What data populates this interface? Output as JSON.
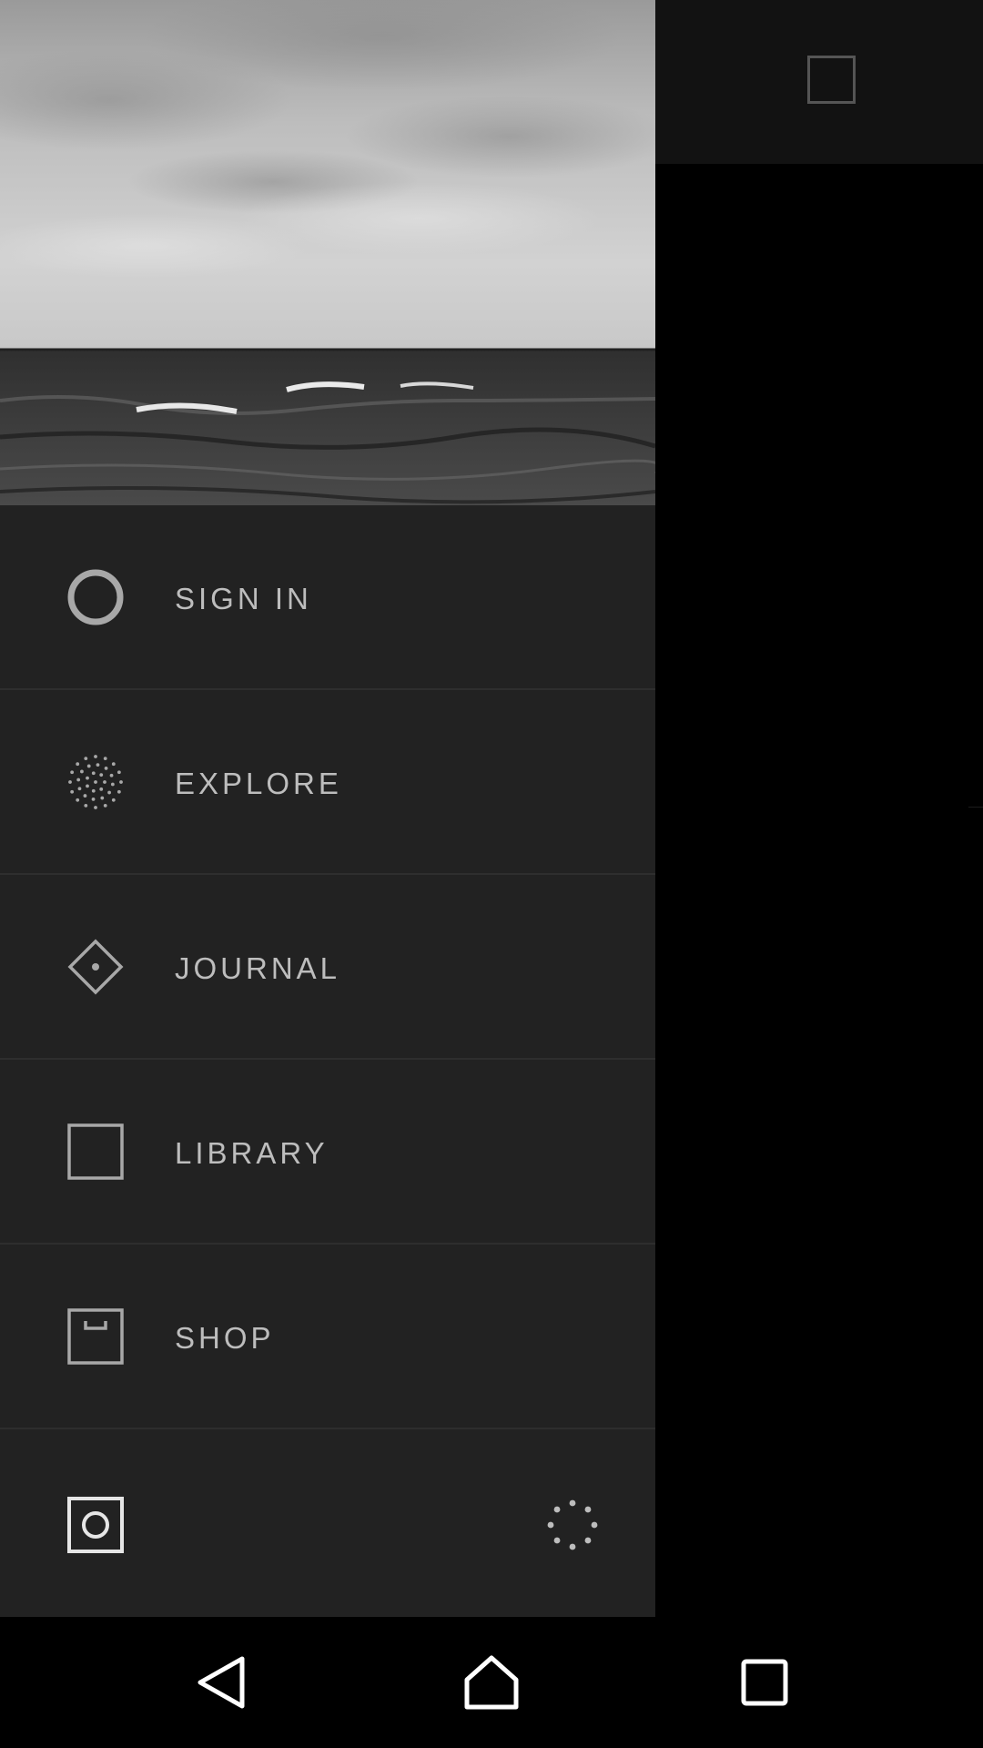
{
  "menu": {
    "items": [
      {
        "label": "SIGN IN",
        "icon": "circle-icon"
      },
      {
        "label": "EXPLORE",
        "icon": "dotted-circle-icon"
      },
      {
        "label": "JOURNAL",
        "icon": "diamond-icon"
      },
      {
        "label": "LIBRARY",
        "icon": "square-icon"
      },
      {
        "label": "SHOP",
        "icon": "shop-box-icon"
      }
    ]
  },
  "footer": {
    "left_icon": "camera-icon",
    "right_icon": "loading-dots-icon"
  },
  "colors": {
    "drawer_bg": "#222222",
    "label": "#bdbdbd",
    "icon": "#b0b0b0"
  },
  "navbar": {
    "buttons": [
      "back-icon",
      "home-icon",
      "recents-icon"
    ]
  }
}
